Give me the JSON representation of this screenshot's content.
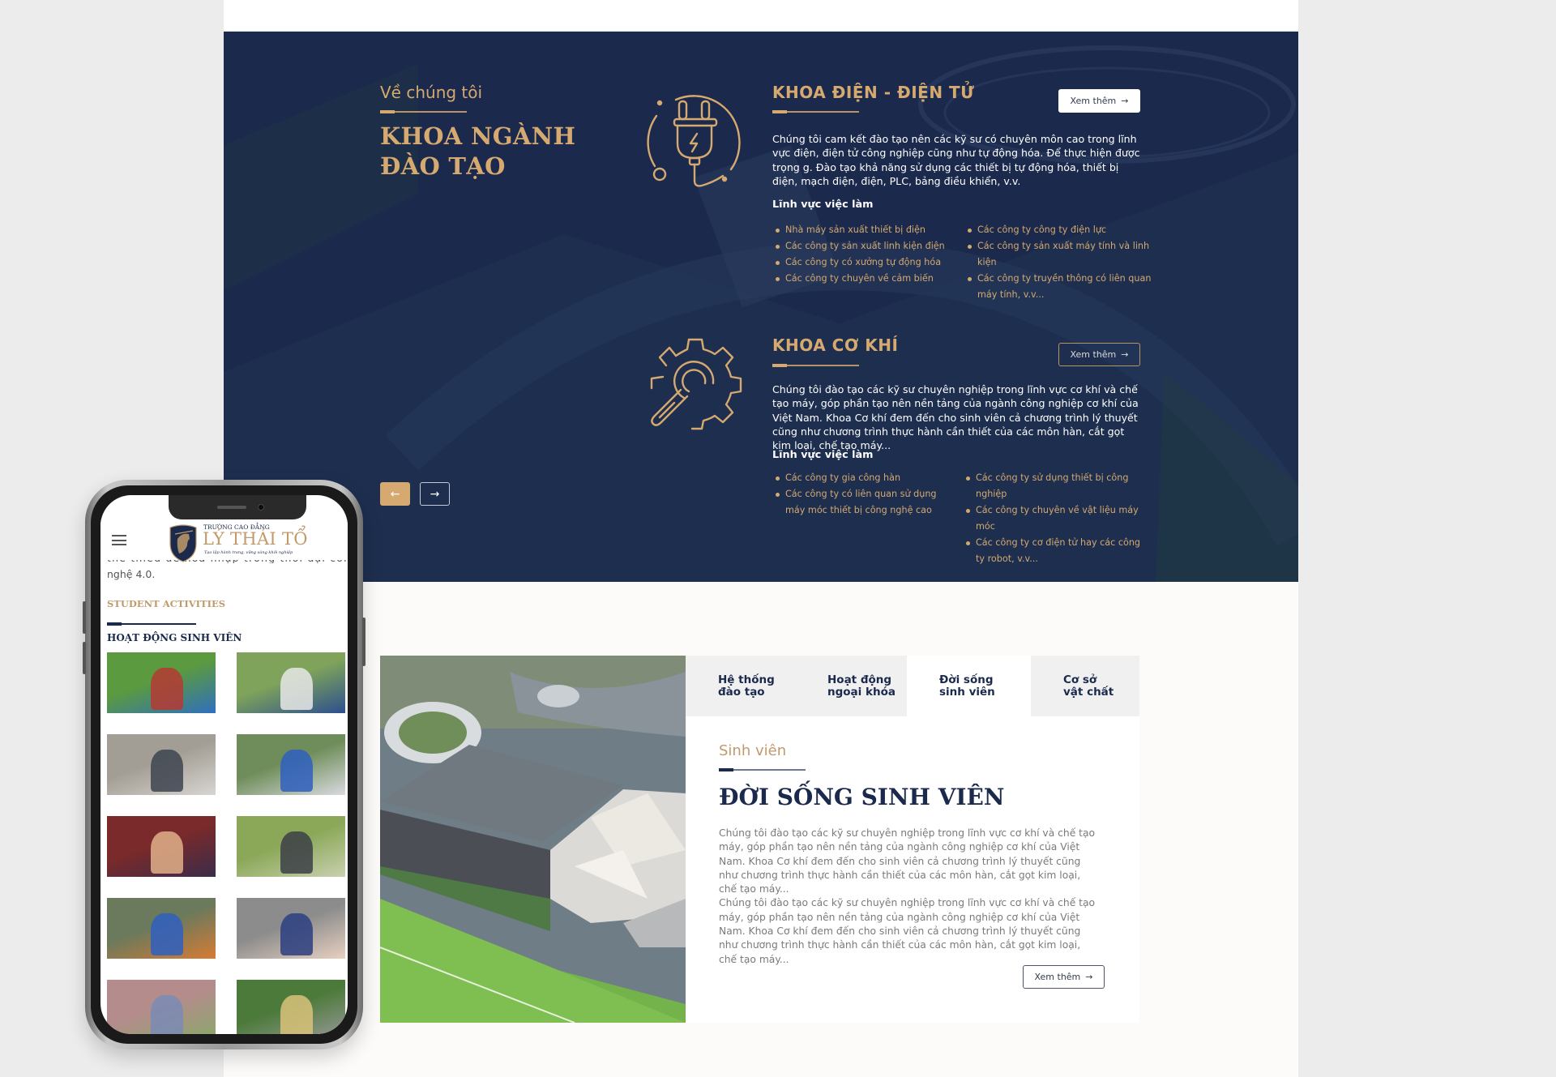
{
  "about": {
    "label": "Về chúng tôi",
    "title_line1": "KHOA NGÀNH",
    "title_line2": "ĐÀO TẠO"
  },
  "departments": [
    {
      "icon": "plug-icon",
      "title": "KHOA ĐIỆN - ĐIỆN TỬ",
      "button": "Xem thêm",
      "description": "Chúng tôi cam kết đào tạo nên các kỹ sư có chuyên môn cao trong lĩnh vực điện, điện tử công nghiệp cũng như tự động hóa. Để thực hiện được trọng g. Đào tạo khả năng sử dụng các thiết bị tự động hóa, thiết bị điện, mạch điện, điện, PLC, bảng điều khiển, v.v.",
      "jobs_heading": "Lĩnh vực việc làm",
      "jobs_left": [
        "Nhà máy sản xuất thiết bị điện",
        "Các công ty sản xuất linh kiện điện",
        "Các công ty có xưởng tự động hóa",
        "Các công ty chuyên về cảm biến"
      ],
      "jobs_right": [
        "Các công ty công ty điện lực",
        "Các công ty sản xuất máy tính và linh kiện",
        "Các công ty truyền thông có liên quan máy tính, v.v..."
      ]
    },
    {
      "icon": "gear-wrench-icon",
      "title": "KHOA CƠ KHÍ",
      "button": "Xem thêm",
      "description": "Chúng tôi đào tạo các kỹ sư chuyên nghiệp trong lĩnh vực cơ khí và chế tạo máy, góp phần tạo nên nền tảng của ngành công nghiệp cơ khí của Việt Nam. Khoa Cơ khí đem đến cho sinh viên cả chương trình lý thuyết cũng như chương trình thực hành cần thiết của các môn hàn, cắt gọt kim loại, chế tạo máy...",
      "jobs_heading": "Lĩnh vực việc làm",
      "jobs_left": [
        "Các công ty gia công hàn",
        "Các công ty có liên quan sử dụng máy móc thiết bị công nghệ cao"
      ],
      "jobs_right": [
        "Các công ty sử dụng thiết bị công nghiệp",
        "Các công ty chuyên về vật liệu máy móc",
        "Các công ty cơ điện tử hay các công ty robot, v.v..."
      ]
    }
  ],
  "slider": {
    "prev_icon": "←",
    "next_icon": "→"
  },
  "student_life": {
    "tabs": [
      {
        "label": "Hệ thống\nđào tạo",
        "active": false
      },
      {
        "label": "Hoạt động\nngoại khóa",
        "active": false
      },
      {
        "label": "Đời sống\nsinh viên",
        "active": true
      },
      {
        "label": "Cơ sở\nvật chất",
        "active": false
      }
    ],
    "label": "Sinh viên",
    "title": "ĐỜI SỐNG SINH VIÊN",
    "paragraph1": "Chúng tôi đào tạo các kỹ sư chuyên nghiệp trong lĩnh vực cơ khí và chế tạo máy, góp phần tạo nên nền tảng của ngành công nghiệp cơ khí của Việt Nam. Khoa Cơ khí đem đến cho sinh viên cả chương trình lý thuyết cũng như chương trình thực hành cần thiết của các môn hàn, cắt gọt kim loại, chế tạo máy...",
    "paragraph2": "Chúng tôi đào tạo các kỹ sư chuyên nghiệp trong lĩnh vực cơ khí và chế tạo máy, góp phần tạo nên nền tảng của ngành công nghiệp cơ khí của Việt Nam. Khoa Cơ khí đem đến cho sinh viên cả chương trình lý thuyết cũng như chương trình thực hành cần thiết của các môn hàn, cắt gọt kim loại, chế tạo máy...",
    "button": "Xem thêm",
    "arrow": "→"
  },
  "mobile": {
    "logo_small": "TRƯỜNG CAO ĐẲNG",
    "logo_big": "LÝ THÁI TỔ",
    "logo_tagline": "Tạo lập hành trang, vững vàng khởi nghiệp",
    "cut_text": "thể thiếu để hòa nhập trong thời đại công",
    "cut_text_end": "nghệ 4.0.",
    "section_label": "STUDENT ACTIVITIES",
    "section_title": "HOẠT ĐỘNG SINH VIÊN",
    "photos": [
      "soccer-players",
      "group-of-students",
      "students-on-steps",
      "students-reading-books",
      "girls-drinking-coffee",
      "student-reading-on-lawn",
      "students-sitting-on-road",
      "students-with-laptop",
      "girl-on-running-track",
      "girls-walking-in-park"
    ]
  },
  "colors": {
    "navy": "#1b2a4c",
    "gold": "#d5a96f",
    "tab_bg": "#f0f0f0"
  }
}
